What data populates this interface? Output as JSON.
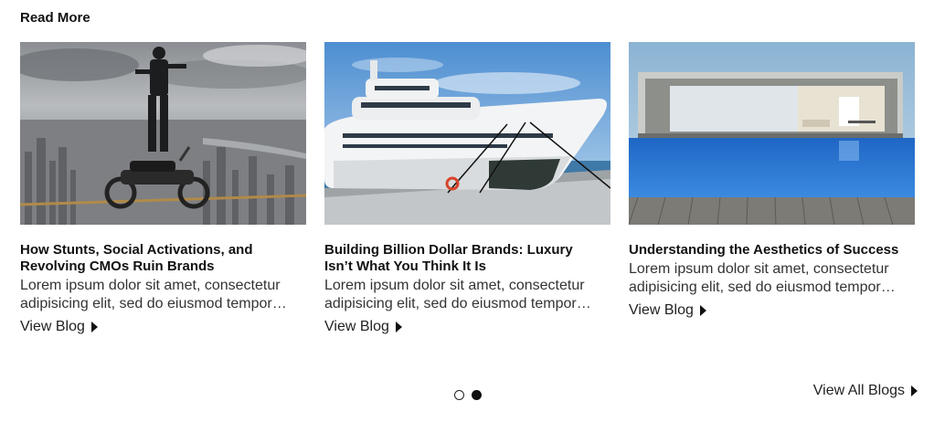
{
  "section": {
    "title": "Read More"
  },
  "cards": [
    {
      "image": "man-on-motorbike-tightrope-image",
      "title": "How Stunts, Social Activations, and Revolving CMOs Ruin Brands",
      "excerpt": "Lorem ipsum dolor sit amet, consectetur adipisicing elit, sed do eiusmod tempor incididunt ut labore",
      "link": "View Blog"
    },
    {
      "image": "luxury-yacht-image",
      "title": "Building Billion Dollar Brands: Luxury Isn’t What You Think It Is",
      "excerpt": "Lorem ipsum dolor sit amet, consectetur adipisicing elit, sed do eiusmod tempor incididunt ut labore",
      "link": "View Blog"
    },
    {
      "image": "infinity-pool-house-image",
      "title": "Understanding the Aesthetics of Success",
      "excerpt": "Lorem ipsum dolor sit amet, consectetur adipisicing elit, sed do eiusmod tempor incididunt ut labore",
      "link": "View Blog"
    }
  ],
  "pagination": {
    "pages": 2,
    "active": 2
  },
  "footer": {
    "view_all": "View All Blogs"
  },
  "icons": {
    "link_arrow": "caret-right-icon"
  }
}
